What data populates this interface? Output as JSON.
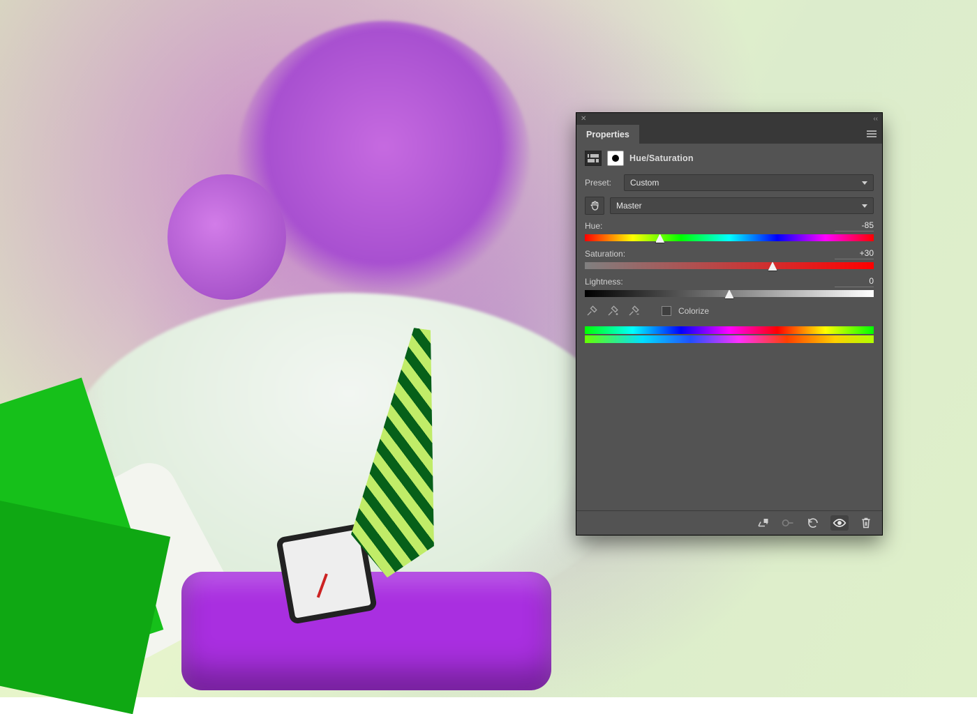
{
  "panel": {
    "tab_title": "Properties",
    "adjustment_name": "Hue/Saturation",
    "preset_label": "Preset:",
    "preset_value": "Custom",
    "range_value": "Master",
    "hue": {
      "label": "Hue:",
      "value": "-85",
      "percent": 26
    },
    "saturation": {
      "label": "Saturation:",
      "value": "+30",
      "percent": 65
    },
    "lightness": {
      "label": "Lightness:",
      "value": "0",
      "percent": 50
    },
    "colorize_label": "Colorize",
    "colorize_checked": false
  }
}
